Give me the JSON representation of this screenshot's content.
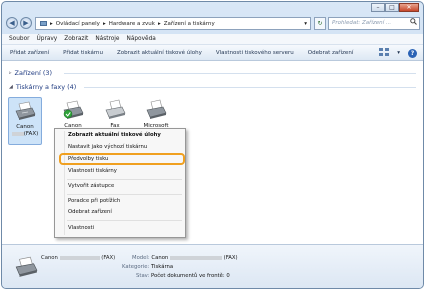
{
  "window": {
    "caption": {
      "minimize": "–",
      "maximize": "□",
      "close": "✕"
    }
  },
  "nav": {
    "back": "◀",
    "forward": "▶"
  },
  "address": {
    "crumbs": [
      "Ovládací panely",
      "Hardware a zvuk",
      "Zařízení a tiskárny"
    ],
    "sep": "▸",
    "dropdown": "▾",
    "refresh": "↻",
    "search_placeholder": "Prohledat: Zařízení ...",
    "search_icon": "search-icon"
  },
  "menubar": [
    "Soubor",
    "Úpravy",
    "Zobrazit",
    "Nástroje",
    "Nápověda"
  ],
  "cmdbar": {
    "items": [
      "Přidat zařízení",
      "Přidat tiskárnu",
      "Zobrazit aktuální tiskové úlohy",
      "Vlastnosti tiskového serveru",
      "Odebrat zařízení"
    ],
    "views_arrow": "▾",
    "help": "?"
  },
  "groups": {
    "devices": {
      "arrow": "▹",
      "label": "Zařízení (3)"
    },
    "printers": {
      "arrow": "◢",
      "label": "Tiskárny a faxy (4)"
    }
  },
  "printers": [
    {
      "name1": "Canon",
      "name2": "(FAX)",
      "selected": true
    },
    {
      "name1": "Canon",
      "name2": "",
      "selected": false
    },
    {
      "name1": "Fax",
      "name2": "",
      "selected": false
    },
    {
      "name1": "Microsoft",
      "name2": "",
      "selected": false
    }
  ],
  "context_menu": [
    {
      "label": "Zobrazit aktuální tiskové úlohy",
      "bold": true
    },
    {
      "label": "Nastavit jako výchozí tiskárnu",
      "bold": false
    },
    {
      "label": "Předvolby tisku",
      "bold": false
    },
    {
      "label": "Vlastnosti tiskárny",
      "bold": false
    },
    {
      "label": "Vytvořit zástupce",
      "bold": false
    },
    {
      "label": "Poradce při potížích",
      "bold": false
    },
    {
      "label": "Odebrat zařízení",
      "bold": false
    },
    {
      "label": "Vlastnosti",
      "bold": false
    }
  ],
  "details": {
    "name_prefix": "Canon",
    "name_suffix": "(FAX)",
    "model_key": "Model:",
    "model_prefix": "Canon",
    "model_suffix": "(FAX)",
    "category_key": "Kategorie:",
    "category_val": "Tiskárna",
    "status_key": "Stav:",
    "status_val": "Počet dokumentů ve frontě: 0"
  },
  "colors": {
    "highlight": "#f0a020",
    "selection": "#cde3f8",
    "group_header": "#1e3a80"
  }
}
